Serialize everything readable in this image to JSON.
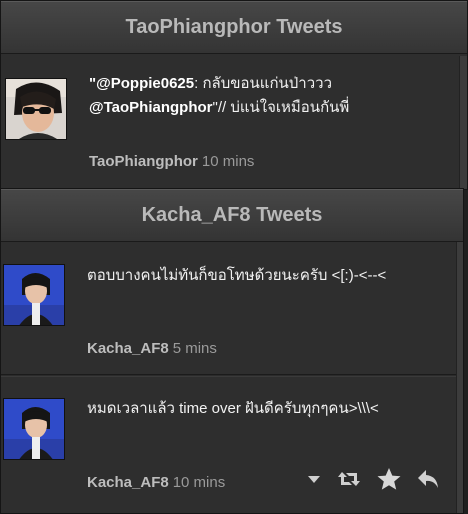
{
  "panel1": {
    "title": "TaoPhiangphor Tweets",
    "tweet": {
      "mention1": "\"@Poppie0625",
      "text1": ": กลับขอนแก่นป่าววว",
      "mention2": "@TaoPhiangphor",
      "text2": "\"// บ่แน่ใจเหมือนกันพี่",
      "user": "TaoPhiangphor",
      "time": "10 mins"
    }
  },
  "panel2": {
    "title": "Kacha_AF8 Tweets",
    "tweets": [
      {
        "text": "ตอบบางคนไม่ทันก็ขอโทษด้วยนะครับ <[:)-<--<",
        "user": "Kacha_AF8",
        "time": "5 mins"
      },
      {
        "text": "หมดเวลาแล้ว time over ฝันดีครับทุกๆคน>\\\\\\<",
        "user": "Kacha_AF8",
        "time": "10 mins"
      }
    ]
  },
  "icons": {
    "dropdown": "chevron-down-icon",
    "retweet": "retweet-icon",
    "favorite": "star-icon",
    "reply": "reply-icon"
  }
}
